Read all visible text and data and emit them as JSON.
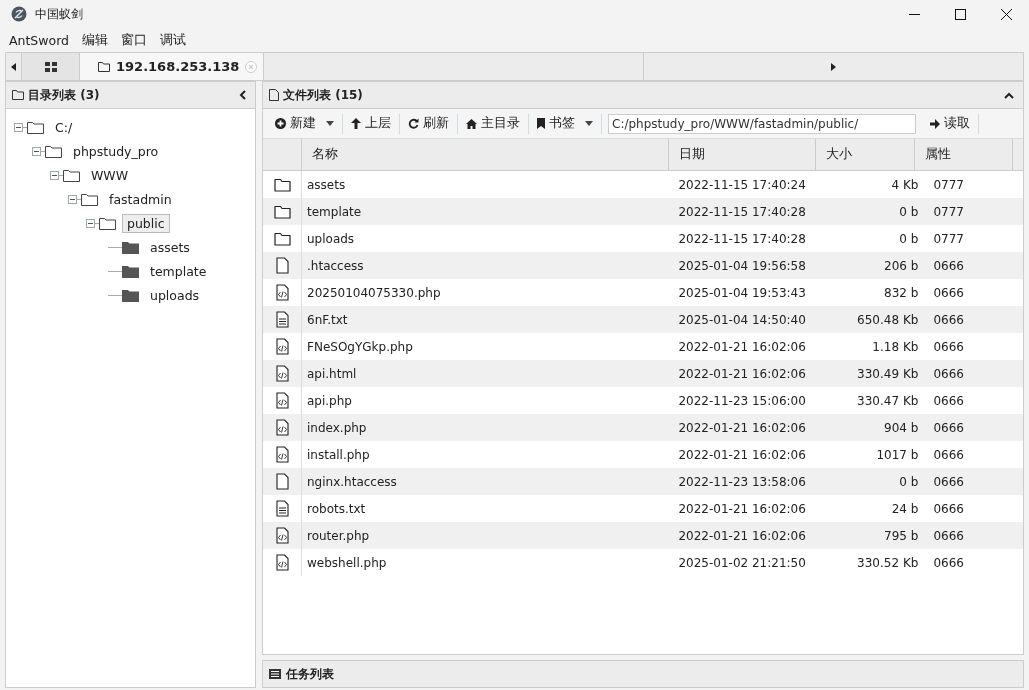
{
  "window": {
    "title": "中国蚁剑"
  },
  "menu": [
    "AntSword",
    "编辑",
    "窗口",
    "调试"
  ],
  "tabs": [
    {
      "kind": "grid",
      "selected": false
    },
    {
      "kind": "folder",
      "label": "192.168.253.138",
      "selected": true
    }
  ],
  "tree_panel": {
    "title": "目录列表 (3)",
    "tree": [
      {
        "label": "C:/",
        "expanded": true,
        "selected": false,
        "children": [
          {
            "label": "phpstudy_pro",
            "expanded": true,
            "selected": false,
            "children": [
              {
                "label": "WWW",
                "expanded": true,
                "selected": false,
                "children": [
                  {
                    "label": "fastadmin",
                    "expanded": true,
                    "selected": false,
                    "children": [
                      {
                        "label": "public",
                        "expanded": true,
                        "selected": true,
                        "children": [
                          {
                            "label": "assets",
                            "selected": false
                          },
                          {
                            "label": "template",
                            "selected": false
                          },
                          {
                            "label": "uploads",
                            "selected": false
                          }
                        ]
                      }
                    ]
                  }
                ]
              }
            ]
          }
        ]
      }
    ]
  },
  "file_panel": {
    "title": "文件列表 (15)",
    "toolbar": [
      {
        "kind": "new",
        "label": "新建",
        "dropdown": true
      },
      {
        "kind": "up",
        "label": "上层",
        "dropdown": false
      },
      {
        "kind": "refresh",
        "label": "刷新",
        "dropdown": false
      },
      {
        "kind": "home",
        "label": "主目录",
        "dropdown": false
      },
      {
        "kind": "bookmark",
        "label": "书签",
        "dropdown": true
      }
    ],
    "path": "C:/phpstudy_pro/WWW/fastadmin/public/",
    "read_button": "读取",
    "columns": [
      "名称",
      "日期",
      "大小",
      "属性"
    ],
    "rows": [
      {
        "kind": "folder",
        "name": "assets",
        "date": "2022-11-15 17:40:24",
        "size": "4 Kb",
        "attr": "0777"
      },
      {
        "kind": "folder",
        "name": "template",
        "date": "2022-11-15 17:40:28",
        "size": "0 b",
        "attr": "0777"
      },
      {
        "kind": "folder",
        "name": "uploads",
        "date": "2022-11-15 17:40:28",
        "size": "0 b",
        "attr": "0777"
      },
      {
        "kind": "file",
        "name": ".htaccess",
        "date": "2025-01-04 19:56:58",
        "size": "206 b",
        "attr": "0666"
      },
      {
        "kind": "code",
        "name": "20250104075330.php",
        "date": "2025-01-04 19:53:43",
        "size": "832 b",
        "attr": "0666"
      },
      {
        "kind": "text",
        "name": "6nF.txt",
        "date": "2025-01-04 14:50:40",
        "size": "650.48 Kb",
        "attr": "0666"
      },
      {
        "kind": "code",
        "name": "FNeSOgYGkp.php",
        "date": "2022-01-21 16:02:06",
        "size": "1.18 Kb",
        "attr": "0666"
      },
      {
        "kind": "code",
        "name": "api.html",
        "date": "2022-01-21 16:02:06",
        "size": "330.49 Kb",
        "attr": "0666"
      },
      {
        "kind": "code",
        "name": "api.php",
        "date": "2022-11-23 15:06:00",
        "size": "330.47 Kb",
        "attr": "0666"
      },
      {
        "kind": "code",
        "name": "index.php",
        "date": "2022-01-21 16:02:06",
        "size": "904 b",
        "attr": "0666"
      },
      {
        "kind": "code",
        "name": "install.php",
        "date": "2022-01-21 16:02:06",
        "size": "1017 b",
        "attr": "0666"
      },
      {
        "kind": "file",
        "name": "nginx.htaccess",
        "date": "2022-11-23 13:58:06",
        "size": "0 b",
        "attr": "0666"
      },
      {
        "kind": "text",
        "name": "robots.txt",
        "date": "2022-01-21 16:02:06",
        "size": "24 b",
        "attr": "0666"
      },
      {
        "kind": "code",
        "name": "router.php",
        "date": "2022-01-21 16:02:06",
        "size": "795 b",
        "attr": "0666"
      },
      {
        "kind": "code",
        "name": "webshell.php",
        "date": "2025-01-02 21:21:50",
        "size": "330.52 Kb",
        "attr": "0666"
      }
    ]
  },
  "task_panel": {
    "title": "任务列表"
  }
}
